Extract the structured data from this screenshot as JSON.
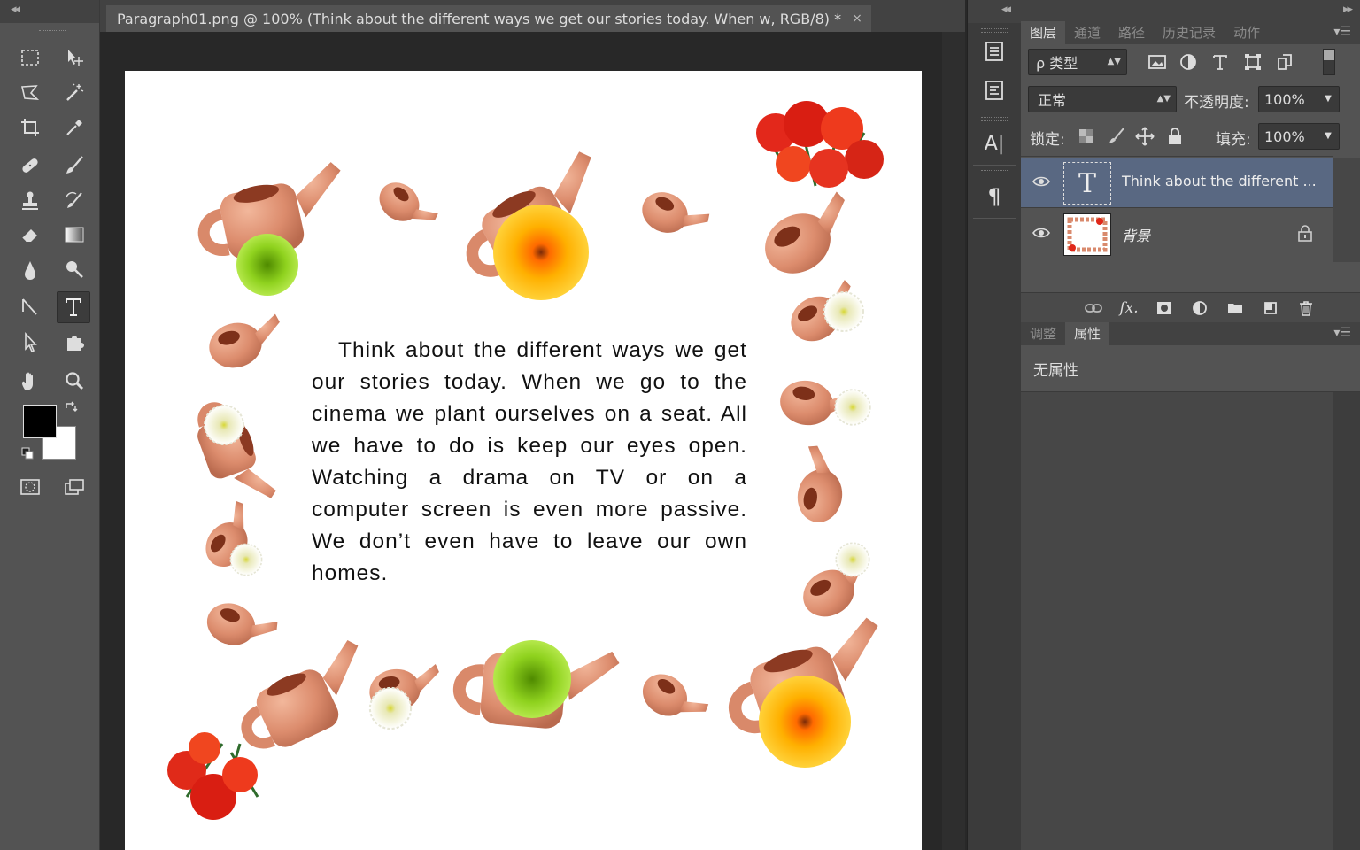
{
  "document": {
    "tab_title": "Paragraph01.png @ 100% (Think about the different ways we get our stories today. When w, RGB/8) *",
    "close_glyph": "×",
    "paragraph_text": "Think about the different ways we get our stories today. When we go to the cinema we plant ourselves on a seat. All we have to do is keep our eyes open. Watching a drama on TV or on a computer screen is even more passive. We don’t even have to leave our own homes."
  },
  "toolbar": {
    "collapse_glyph": "◂◂",
    "tools": [
      "rectangular-marquee-tool",
      "move-tool",
      "polygonal-lasso-tool",
      "magic-wand-tool",
      "crop-tool",
      "eyedropper-tool",
      "spot-healing-tool",
      "brush-tool",
      "clone-stamp-tool",
      "history-brush-tool",
      "eraser-tool",
      "gradient-tool",
      "blur-tool",
      "dodge-tool",
      "path-selection-tool",
      "type-tool",
      "direct-selection-tool",
      "custom-shape-tool",
      "hand-tool",
      "zoom-tool"
    ],
    "active_tool": "type-tool",
    "foreground_color": "#000000",
    "background_color": "#ffffff"
  },
  "dock_strip": {
    "collapse_glyph": "◂◂",
    "buttons": [
      "history-panel-icon",
      "properties-panel-icon",
      "character-panel-icon",
      "paragraph-panel-icon"
    ],
    "character_label": "A|",
    "paragraph_label": "¶"
  },
  "panels": {
    "collapse_glyph": "▸▸",
    "menu_glyph": "▾☰",
    "layer_tabs": [
      "图层",
      "通道",
      "路径",
      "历史记录",
      "动作"
    ],
    "active_layer_tab": "图层",
    "filter_kind": "ρ 类型",
    "blend_mode": "正常",
    "opacity_label": "不透明度:",
    "opacity_value": "100%",
    "lock_label": "锁定:",
    "fill_label": "填充:",
    "fill_value": "100%",
    "layers": [
      {
        "name": "Think about the different ...",
        "type": "text",
        "selected": true,
        "thumb_glyph": "T"
      },
      {
        "name": "背景",
        "type": "image",
        "selected": false,
        "locked": true
      }
    ],
    "fx_label": "fx.",
    "props_tabs": [
      "调整",
      "属性"
    ],
    "active_props_tab": "属性",
    "props_message": "无属性"
  },
  "colors": {
    "selected_layer": "#596882",
    "panel_bg": "#535353",
    "workspace_bg": "#282828"
  }
}
